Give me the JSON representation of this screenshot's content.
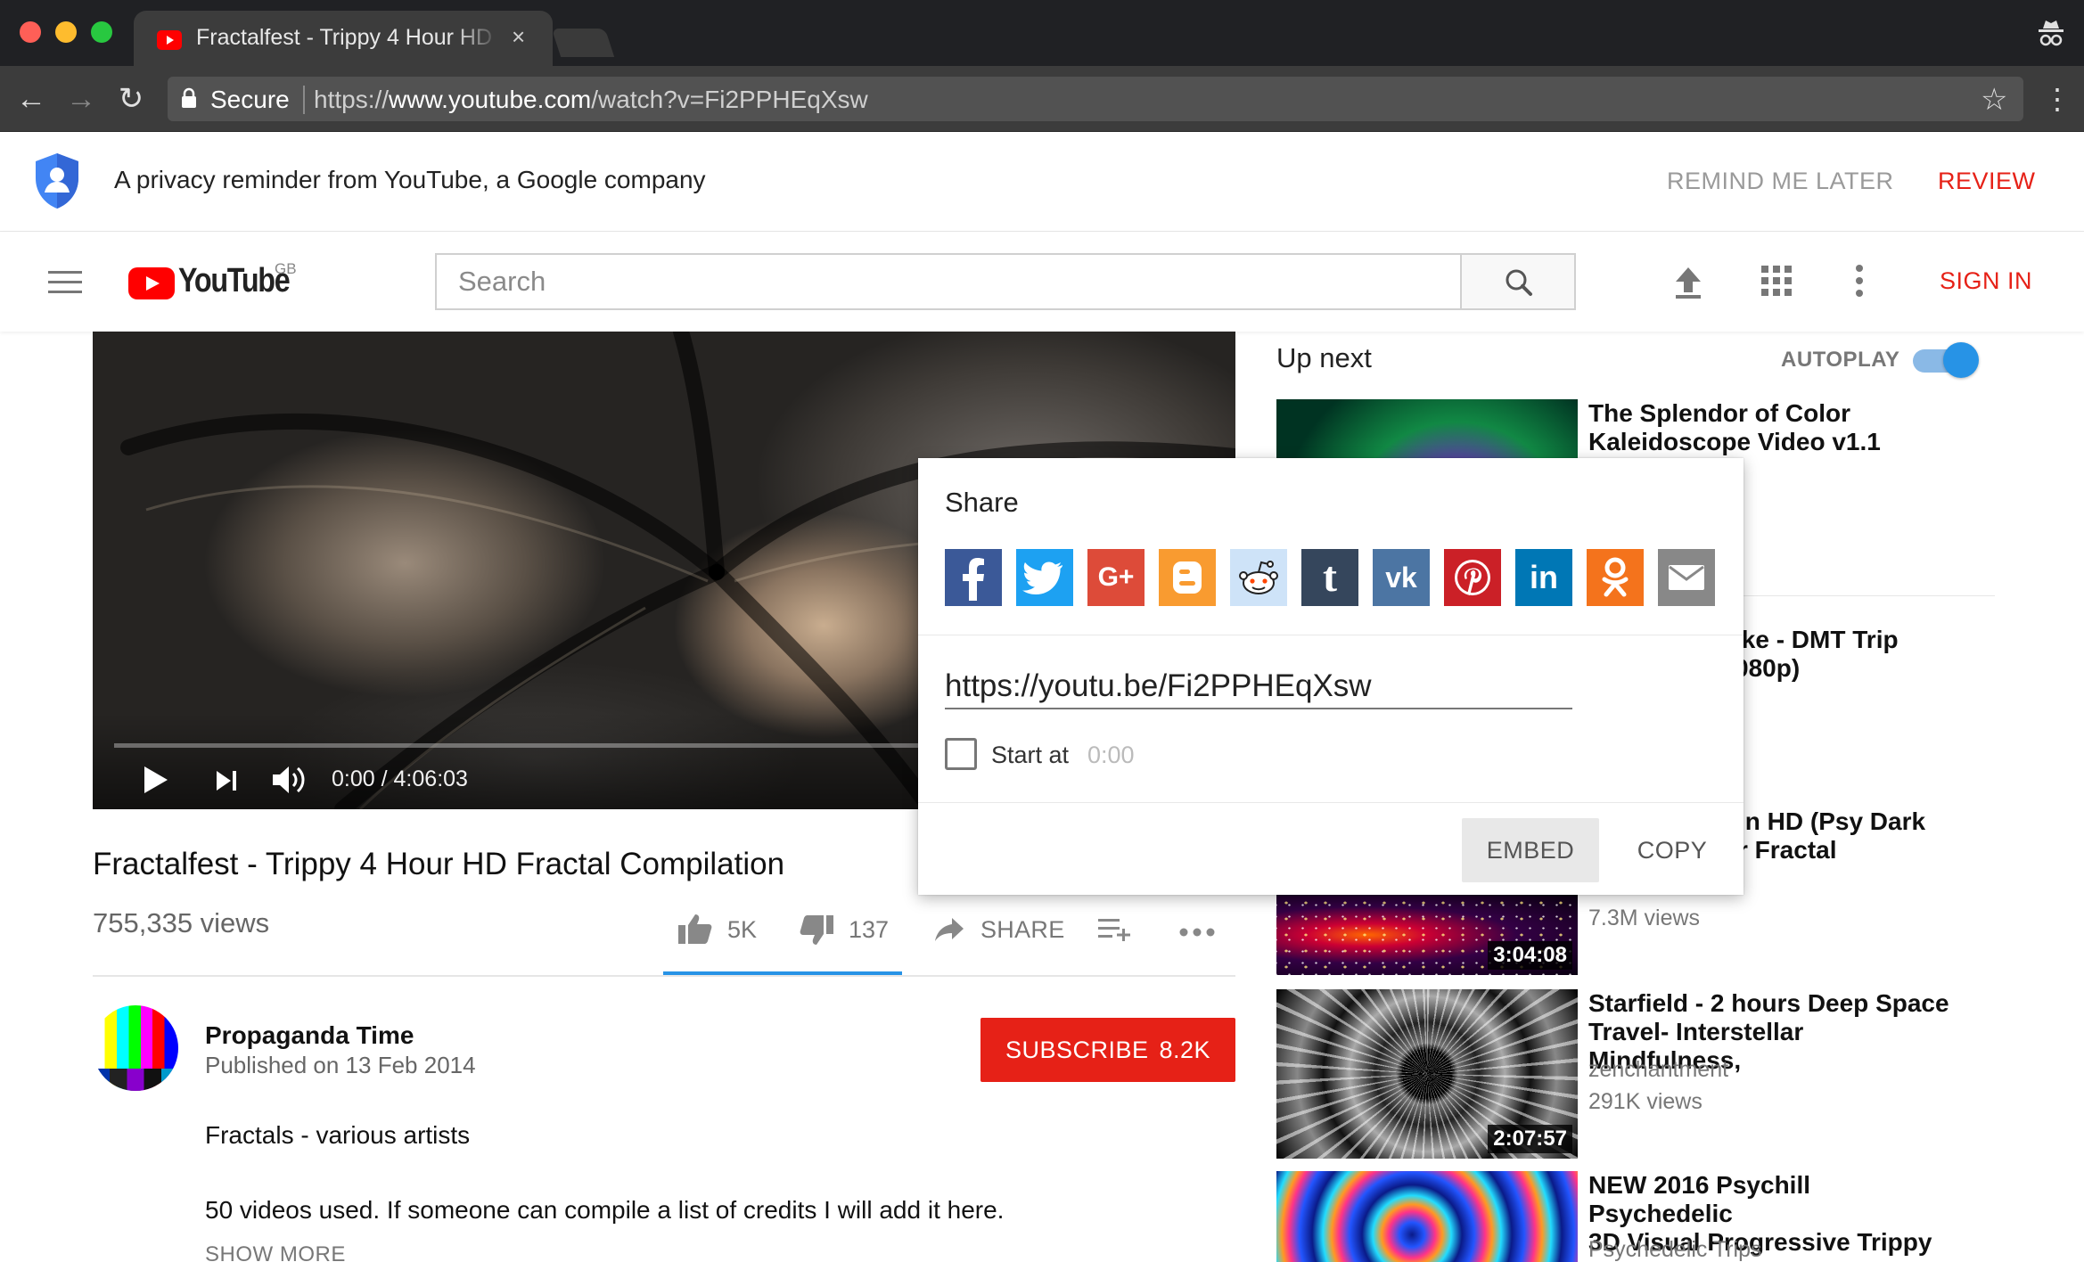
{
  "browser": {
    "tab_title": "Fractalfest - Trippy 4 Hour HD Fractal Compilation",
    "tab_close": "×",
    "secure_label": "Secure",
    "url_scheme": "https://",
    "url_host": "www.youtube.com",
    "url_path": "/watch?v=Fi2PPHEqXsw",
    "back_icon": "←",
    "forward_icon": "→",
    "reload_icon": "↻",
    "bookmark_icon": "☆",
    "menu_icon": "⋮"
  },
  "privacy_banner": {
    "text": "A privacy reminder from YouTube, a Google company",
    "remind_later": "REMIND ME LATER",
    "review": "REVIEW"
  },
  "header": {
    "logo_text": "YouTube",
    "region": "GB",
    "search_placeholder": "Search",
    "sign_in": "SIGN IN"
  },
  "player": {
    "time_current": "0:00",
    "time_separator": "/",
    "time_total": "4:06:03",
    "progress": 0
  },
  "video": {
    "title": "Fractalfest - Trippy 4 Hour HD Fractal Compilation",
    "views": "755,335 views",
    "likes": "5K",
    "dislikes": "137",
    "share_label": "SHARE",
    "like_ratio": 0.973
  },
  "channel": {
    "name": "Propaganda Time",
    "published": "Published on 13 Feb 2014",
    "subscribe_label": "SUBSCRIBE",
    "subscriber_count": "8.2K"
  },
  "description": {
    "line1": "Fractals - various artists",
    "line2": "50 videos used. If someone can compile a list of credits I will add it here.",
    "show_more": "SHOW MORE"
  },
  "sidebar": {
    "up_next": "Up next",
    "autoplay": "AUTOPLAY",
    "autoplay_on": true,
    "items": [
      {
        "title_line1": "The Splendor of Color",
        "title_line2": "Kaleidoscope Video v1.1 1080p"
      },
      {
        "title_line1": "ike - DMT Trip",
        "title_line2": "080p)"
      },
      {
        "title_line1": "in HD (Psy Dark",
        "title_line2": "r Fractal",
        "views": "7.3M views",
        "duration": "3:04:08"
      },
      {
        "title_line1": "Starfield - 2 hours Deep Space",
        "title_line2": "Travel- Interstellar Mindfulness,",
        "channel": "zenchantment",
        "views": "291K views",
        "duration": "2:07:57"
      },
      {
        "title_line1": "NEW 2016 Psychill Psychedelic",
        "title_line2": "3D Visual Progressive Trippy",
        "channel": "Psychedelic Trips"
      }
    ]
  },
  "share_dialog": {
    "title": "Share",
    "services": [
      {
        "name": "Facebook",
        "glyph": "f",
        "color": "#3b5998"
      },
      {
        "name": "Twitter",
        "glyph": "",
        "color": "#1da1f2"
      },
      {
        "name": "Google+",
        "glyph": "G+",
        "color": "#dd4b39"
      },
      {
        "name": "Blogger",
        "glyph": "",
        "color": "#f99b30"
      },
      {
        "name": "Reddit",
        "glyph": "",
        "color": "#cee3f8"
      },
      {
        "name": "Tumblr",
        "glyph": "t",
        "color": "#35465c"
      },
      {
        "name": "VK",
        "glyph": "vk",
        "color": "#4c75a3"
      },
      {
        "name": "Pinterest",
        "glyph": "",
        "color": "#cb2027"
      },
      {
        "name": "LinkedIn",
        "glyph": "in",
        "color": "#0077b5"
      },
      {
        "name": "Odnoklassniki",
        "glyph": "",
        "color": "#f4731c"
      },
      {
        "name": "Email",
        "glyph": "",
        "color": "#888888"
      }
    ],
    "short_url": "https://youtu.be/Fi2PPHEqXsw",
    "start_at_label": "Start at",
    "start_at_value": "0:00",
    "embed": "EMBED",
    "copy": "COPY"
  }
}
